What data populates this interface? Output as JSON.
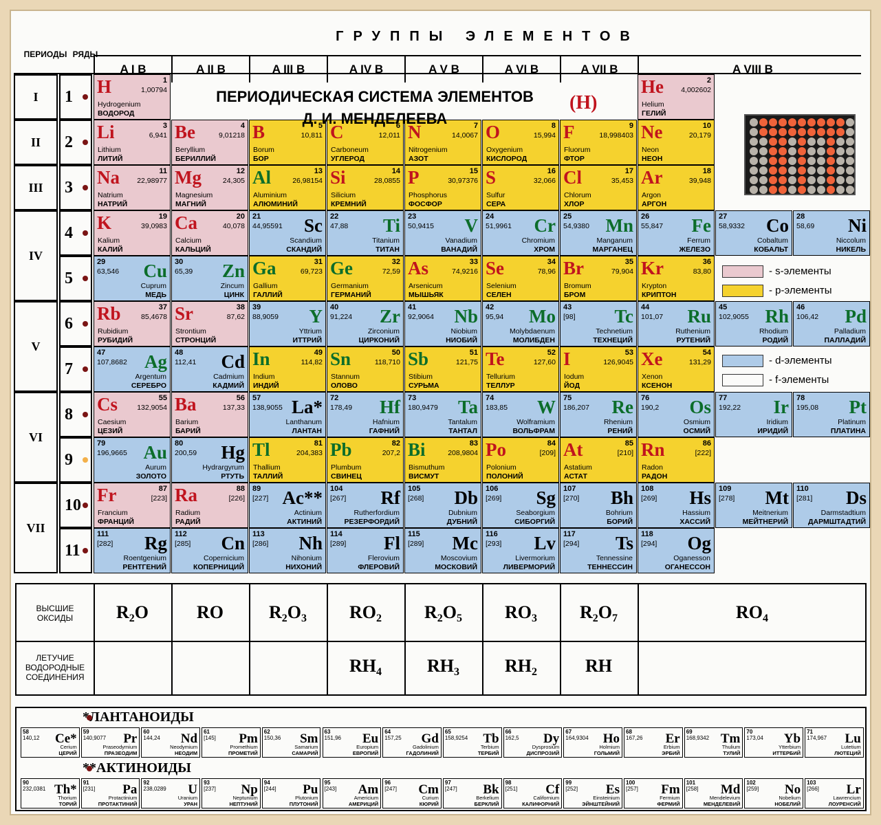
{
  "header": {
    "periods_label": "ПЕРИОДЫ",
    "rows_label": "РЯДЫ",
    "groups_title": "ГРУППЫ ЭЛЕМЕНТОВ",
    "group_labels": [
      "A I B",
      "A II B",
      "A III B",
      "A IV B",
      "A V B",
      "A VI B",
      "A VII B",
      "A VIII B"
    ]
  },
  "title": {
    "line1": "ПЕРИОДИЧЕСКАЯ СИСТЕМА ЭЛЕМЕНТОВ",
    "line2": "Д. И. МЕНДЕЛЕЕВА",
    "hydrogen_marker": "(H)"
  },
  "periods": [
    "I",
    "II",
    "III",
    "IV",
    "V",
    "VI",
    "VII"
  ],
  "rows": [
    "1",
    "2",
    "3",
    "4",
    "5",
    "6",
    "7",
    "8",
    "9",
    "10",
    "11"
  ],
  "legend": [
    "- s-элементы",
    "- p-элементы",
    "- d-элементы",
    "- f-элементы"
  ],
  "elements": [
    {
      "sym": "H",
      "num": "1",
      "mass": "1,00794",
      "lat": "Hydrogenium",
      "rus": "ВОДОРОД",
      "type": "s"
    },
    {
      "sym": "He",
      "num": "2",
      "mass": "4,002602",
      "lat": "Helium",
      "rus": "ГЕЛИЙ",
      "type": "s"
    },
    {
      "sym": "Li",
      "num": "3",
      "mass": "6,941",
      "lat": "Lithium",
      "rus": "ЛИТИЙ",
      "type": "s"
    },
    {
      "sym": "Be",
      "num": "4",
      "mass": "9,01218",
      "lat": "Beryllium",
      "rus": "БЕРИЛЛИЙ",
      "type": "s"
    },
    {
      "sym": "B",
      "num": "5",
      "mass": "10,811",
      "lat": "Borum",
      "rus": "БОР",
      "type": "p"
    },
    {
      "sym": "C",
      "num": "6",
      "mass": "12,011",
      "lat": "Carboneum",
      "rus": "УГЛЕРОД",
      "type": "p"
    },
    {
      "sym": "N",
      "num": "7",
      "mass": "14,0067",
      "lat": "Nitrogenium",
      "rus": "АЗОТ",
      "type": "p"
    },
    {
      "sym": "O",
      "num": "8",
      "mass": "15,994",
      "lat": "Oxygenium",
      "rus": "КИСЛОРОД",
      "type": "p"
    },
    {
      "sym": "F",
      "num": "9",
      "mass": "18,998403",
      "lat": "Fluorum",
      "rus": "ФТОР",
      "type": "p"
    },
    {
      "sym": "Ne",
      "num": "10",
      "mass": "20,179",
      "lat": "Neon",
      "rus": "НЕОН",
      "type": "p"
    },
    {
      "sym": "Na",
      "num": "11",
      "mass": "22,98977",
      "lat": "Natrium",
      "rus": "НАТРИЙ",
      "type": "s"
    },
    {
      "sym": "Mg",
      "num": "12",
      "mass": "24,305",
      "lat": "Magnesium",
      "rus": "МАГНИЙ",
      "type": "s"
    },
    {
      "sym": "Al",
      "num": "13",
      "mass": "26,98154",
      "lat": "Aluminium",
      "rus": "АЛЮМИНИЙ",
      "type": "p"
    },
    {
      "sym": "Si",
      "num": "14",
      "mass": "28,0855",
      "lat": "Silicium",
      "rus": "КРЕМНИЙ",
      "type": "p"
    },
    {
      "sym": "P",
      "num": "15",
      "mass": "30,97376",
      "lat": "Phosphorus",
      "rus": "ФОСФОР",
      "type": "p"
    },
    {
      "sym": "S",
      "num": "16",
      "mass": "32,066",
      "lat": "Sulfur",
      "rus": "СЕРА",
      "type": "p"
    },
    {
      "sym": "Cl",
      "num": "17",
      "mass": "35,453",
      "lat": "Chlorum",
      "rus": "ХЛОР",
      "type": "p"
    },
    {
      "sym": "Ar",
      "num": "18",
      "mass": "39,948",
      "lat": "Argon",
      "rus": "АРГОН",
      "type": "p"
    },
    {
      "sym": "K",
      "num": "19",
      "mass": "39,0983",
      "lat": "Kalium",
      "rus": "КАЛИЙ",
      "type": "s"
    },
    {
      "sym": "Ca",
      "num": "20",
      "mass": "40,078",
      "lat": "Calcium",
      "rus": "КАЛЬЦИЙ",
      "type": "s"
    },
    {
      "sym": "Sc",
      "num": "21",
      "mass": "44,95591",
      "lat": "Scandium",
      "rus": "СКАНДИЙ",
      "type": "d"
    },
    {
      "sym": "Ti",
      "num": "22",
      "mass": "47,88",
      "lat": "Titanium",
      "rus": "ТИТАН",
      "type": "d"
    },
    {
      "sym": "V",
      "num": "23",
      "mass": "50,9415",
      "lat": "Vanadium",
      "rus": "ВАНАДИЙ",
      "type": "d"
    },
    {
      "sym": "Cr",
      "num": "24",
      "mass": "51,9961",
      "lat": "Chromium",
      "rus": "ХРОМ",
      "type": "d"
    },
    {
      "sym": "Mn",
      "num": "25",
      "mass": "54,9380",
      "lat": "Manganum",
      "rus": "МАРГАНЕЦ",
      "type": "d"
    },
    {
      "sym": "Fe",
      "num": "26",
      "mass": "55,847",
      "lat": "Ferrum",
      "rus": "ЖЕЛЕЗО",
      "type": "d"
    },
    {
      "sym": "Co",
      "num": "27",
      "mass": "58,9332",
      "lat": "Cobaltum",
      "rus": "КОБАЛЬТ",
      "type": "d"
    },
    {
      "sym": "Ni",
      "num": "28",
      "mass": "58,69",
      "lat": "Niccolum",
      "rus": "НИКЕЛЬ",
      "type": "d"
    },
    {
      "sym": "Cu",
      "num": "29",
      "mass": "63,546",
      "lat": "Cuprum",
      "rus": "МЕДЬ",
      "type": "d"
    },
    {
      "sym": "Zn",
      "num": "30",
      "mass": "65,39",
      "lat": "Zincum",
      "rus": "ЦИНК",
      "type": "d"
    },
    {
      "sym": "Ga",
      "num": "31",
      "mass": "69,723",
      "lat": "Gallium",
      "rus": "ГАЛЛИЙ",
      "type": "p"
    },
    {
      "sym": "Ge",
      "num": "32",
      "mass": "72,59",
      "lat": "Germanium",
      "rus": "ГЕРМАНИЙ",
      "type": "p"
    },
    {
      "sym": "As",
      "num": "33",
      "mass": "74,9216",
      "lat": "Arsenicum",
      "rus": "МЫШЬЯК",
      "type": "p"
    },
    {
      "sym": "Se",
      "num": "34",
      "mass": "78,96",
      "lat": "Selenium",
      "rus": "СЕЛЕН",
      "type": "p"
    },
    {
      "sym": "Br",
      "num": "35",
      "mass": "79,904",
      "lat": "Bromum",
      "rus": "БРОМ",
      "type": "p"
    },
    {
      "sym": "Kr",
      "num": "36",
      "mass": "83,80",
      "lat": "Krypton",
      "rus": "КРИПТОН",
      "type": "p"
    },
    {
      "sym": "Rb",
      "num": "37",
      "mass": "85,4678",
      "lat": "Rubidium",
      "rus": "РУБИДИЙ",
      "type": "s"
    },
    {
      "sym": "Sr",
      "num": "38",
      "mass": "87,62",
      "lat": "Strontium",
      "rus": "СТРОНЦИЙ",
      "type": "s"
    },
    {
      "sym": "Y",
      "num": "39",
      "mass": "88,9059",
      "lat": "Yttrium",
      "rus": "ИТТРИЙ",
      "type": "d"
    },
    {
      "sym": "Zr",
      "num": "40",
      "mass": "91,224",
      "lat": "Zirconium",
      "rus": "ЦИРКОНИЙ",
      "type": "d"
    },
    {
      "sym": "Nb",
      "num": "41",
      "mass": "92,9064",
      "lat": "Niobium",
      "rus": "НИОБИЙ",
      "type": "d"
    },
    {
      "sym": "Mo",
      "num": "42",
      "mass": "95,94",
      "lat": "Molybdaenum",
      "rus": "МОЛИБДЕН",
      "type": "d"
    },
    {
      "sym": "Tc",
      "num": "43",
      "mass": "[98]",
      "lat": "Technetium",
      "rus": "ТЕХНЕЦИЙ",
      "type": "d"
    },
    {
      "sym": "Ru",
      "num": "44",
      "mass": "101,07",
      "lat": "Ruthenium",
      "rus": "РУТЕНИЙ",
      "type": "d"
    },
    {
      "sym": "Rh",
      "num": "45",
      "mass": "102,9055",
      "lat": "Rhodium",
      "rus": "РОДИЙ",
      "type": "d"
    },
    {
      "sym": "Pd",
      "num": "46",
      "mass": "106,42",
      "lat": "Palladium",
      "rus": "ПАЛЛАДИЙ",
      "type": "d"
    },
    {
      "sym": "Ag",
      "num": "47",
      "mass": "107,8682",
      "lat": "Argentum",
      "rus": "СЕРЕБРО",
      "type": "d"
    },
    {
      "sym": "Cd",
      "num": "48",
      "mass": "112,41",
      "lat": "Cadmium",
      "rus": "КАДМИЙ",
      "type": "d"
    },
    {
      "sym": "In",
      "num": "49",
      "mass": "114,82",
      "lat": "Indium",
      "rus": "ИНДИЙ",
      "type": "p"
    },
    {
      "sym": "Sn",
      "num": "50",
      "mass": "118,710",
      "lat": "Stannum",
      "rus": "ОЛОВО",
      "type": "p"
    },
    {
      "sym": "Sb",
      "num": "51",
      "mass": "121,75",
      "lat": "Stibium",
      "rus": "СУРЬМА",
      "type": "p"
    },
    {
      "sym": "Te",
      "num": "52",
      "mass": "127,60",
      "lat": "Tellurium",
      "rus": "ТЕЛЛУР",
      "type": "p"
    },
    {
      "sym": "I",
      "num": "53",
      "mass": "126,9045",
      "lat": "Iodum",
      "rus": "ЙОД",
      "type": "p"
    },
    {
      "sym": "Xe",
      "num": "54",
      "mass": "131,29",
      "lat": "Xenon",
      "rus": "КСЕНОН",
      "type": "p"
    },
    {
      "sym": "Cs",
      "num": "55",
      "mass": "132,9054",
      "lat": "Caesium",
      "rus": "ЦЕЗИЙ",
      "type": "s"
    },
    {
      "sym": "Ba",
      "num": "56",
      "mass": "137,33",
      "lat": "Barium",
      "rus": "БАРИЙ",
      "type": "s"
    },
    {
      "sym": "La*",
      "num": "57",
      "mass": "138,9055",
      "lat": "Lanthanum",
      "rus": "ЛАНТАН",
      "type": "d"
    },
    {
      "sym": "Hf",
      "num": "72",
      "mass": "178,49",
      "lat": "Hafnium",
      "rus": "ГАФНИЙ",
      "type": "d"
    },
    {
      "sym": "Ta",
      "num": "73",
      "mass": "180,9479",
      "lat": "Tantalum",
      "rus": "ТАНТАЛ",
      "type": "d"
    },
    {
      "sym": "W",
      "num": "74",
      "mass": "183,85",
      "lat": "Wolframium",
      "rus": "ВОЛЬФРАМ",
      "type": "d"
    },
    {
      "sym": "Re",
      "num": "75",
      "mass": "186,207",
      "lat": "Rhenium",
      "rus": "РЕНИЙ",
      "type": "d"
    },
    {
      "sym": "Os",
      "num": "76",
      "mass": "190,2",
      "lat": "Osmium",
      "rus": "ОСМИЙ",
      "type": "d"
    },
    {
      "sym": "Ir",
      "num": "77",
      "mass": "192,22",
      "lat": "Iridium",
      "rus": "ИРИДИЙ",
      "type": "d"
    },
    {
      "sym": "Pt",
      "num": "78",
      "mass": "195,08",
      "lat": "Platinum",
      "rus": "ПЛАТИНА",
      "type": "d"
    },
    {
      "sym": "Au",
      "num": "79",
      "mass": "196,9665",
      "lat": "Aurum",
      "rus": "ЗОЛОТО",
      "type": "d"
    },
    {
      "sym": "Hg",
      "num": "80",
      "mass": "200,59",
      "lat": "Hydrargyrum",
      "rus": "РТУТЬ",
      "type": "d"
    },
    {
      "sym": "Tl",
      "num": "81",
      "mass": "204,383",
      "lat": "Thallium",
      "rus": "ТАЛЛИЙ",
      "type": "p"
    },
    {
      "sym": "Pb",
      "num": "82",
      "mass": "207,2",
      "lat": "Plumbum",
      "rus": "СВИНЕЦ",
      "type": "p"
    },
    {
      "sym": "Bi",
      "num": "83",
      "mass": "208,9804",
      "lat": "Bismuthum",
      "rus": "ВИСМУТ",
      "type": "p"
    },
    {
      "sym": "Po",
      "num": "84",
      "mass": "[209]",
      "lat": "Polonium",
      "rus": "ПОЛОНИЙ",
      "type": "p"
    },
    {
      "sym": "At",
      "num": "85",
      "mass": "[210]",
      "lat": "Astatium",
      "rus": "АСТАТ",
      "type": "p"
    },
    {
      "sym": "Rn",
      "num": "86",
      "mass": "[222]",
      "lat": "Radon",
      "rus": "РАДОН",
      "type": "p"
    },
    {
      "sym": "Fr",
      "num": "87",
      "mass": "[223]",
      "lat": "Francium",
      "rus": "ФРАНЦИЙ",
      "type": "s"
    },
    {
      "sym": "Ra",
      "num": "88",
      "mass": "[226]",
      "lat": "Radium",
      "rus": "РАДИЙ",
      "type": "s"
    },
    {
      "sym": "Ac**",
      "num": "89",
      "mass": "[227]",
      "lat": "Actinium",
      "rus": "АКТИНИЙ",
      "type": "d"
    },
    {
      "sym": "Rf",
      "num": "104",
      "mass": "[267]",
      "lat": "Rutherfordium",
      "rus": "РЕЗЕРФОРДИЙ",
      "type": "d"
    },
    {
      "sym": "Db",
      "num": "105",
      "mass": "[268]",
      "lat": "Dubnium",
      "rus": "ДУБНИЙ",
      "type": "d"
    },
    {
      "sym": "Sg",
      "num": "106",
      "mass": "[269]",
      "lat": "Seaborgium",
      "rus": "СИБОРГИЙ",
      "type": "d"
    },
    {
      "sym": "Bh",
      "num": "107",
      "mass": "[270]",
      "lat": "Bohrium",
      "rus": "БОРИЙ",
      "type": "d"
    },
    {
      "sym": "Hs",
      "num": "108",
      "mass": "[269]",
      "lat": "Hassium",
      "rus": "ХАССИЙ",
      "type": "d"
    },
    {
      "sym": "Mt",
      "num": "109",
      "mass": "[278]",
      "lat": "Meitnerium",
      "rus": "МЕЙТНЕРИЙ",
      "type": "d"
    },
    {
      "sym": "Ds",
      "num": "110",
      "mass": "[281]",
      "lat": "Darmstadtium",
      "rus": "ДАРМШТАДТИЙ",
      "type": "d"
    },
    {
      "sym": "Rg",
      "num": "111",
      "mass": "[282]",
      "lat": "Roentgenium",
      "rus": "РЕНТГЕНИЙ",
      "type": "d"
    },
    {
      "sym": "Cn",
      "num": "112",
      "mass": "[285]",
      "lat": "Copernicium",
      "rus": "КОПЕРНИЦИЙ",
      "type": "d"
    },
    {
      "sym": "Nh",
      "num": "113",
      "mass": "[286]",
      "lat": "Nihonium",
      "rus": "НИХОНИЙ",
      "type": "d"
    },
    {
      "sym": "Fl",
      "num": "114",
      "mass": "[289]",
      "lat": "Flerovium",
      "rus": "ФЛЕРОВИЙ",
      "type": "d"
    },
    {
      "sym": "Mc",
      "num": "115",
      "mass": "[289]",
      "lat": "Moscovium",
      "rus": "МОСКОВИЙ",
      "type": "d"
    },
    {
      "sym": "Lv",
      "num": "116",
      "mass": "[293]",
      "lat": "Livermorium",
      "rus": "ЛИВЕРМОРИЙ",
      "type": "d"
    },
    {
      "sym": "Ts",
      "num": "117",
      "mass": "[294]",
      "lat": "Tennessine",
      "rus": "ТЕННЕССИН",
      "type": "d"
    },
    {
      "sym": "Og",
      "num": "118",
      "mass": "[294]",
      "lat": "Oganesson",
      "rus": "ОГАНЕССОН",
      "type": "d"
    }
  ],
  "oxides_label": "ВЫСШИЕ ОКСИДЫ",
  "hydrides_label": "ЛЕТУЧИЕ ВОДОРОДНЫЕ СОЕДИНЕНИЯ",
  "oxides": [
    {
      "base": "R",
      "s1": "2",
      "mid": "O",
      "s2": ""
    },
    {
      "base": "RO",
      "s1": "",
      "mid": "",
      "s2": ""
    },
    {
      "base": "R",
      "s1": "2",
      "mid": "O",
      "s2": "3"
    },
    {
      "base": "RO",
      "s1": "2",
      "mid": "",
      "s2": ""
    },
    {
      "base": "R",
      "s1": "2",
      "mid": "O",
      "s2": "5"
    },
    {
      "base": "RO",
      "s1": "3",
      "mid": "",
      "s2": ""
    },
    {
      "base": "R",
      "s1": "2",
      "mid": "O",
      "s2": "7"
    },
    {
      "base": "RO",
      "s1": "4",
      "mid": "",
      "s2": ""
    }
  ],
  "hydrides": [
    {
      "base": "RH",
      "s1": "4"
    },
    {
      "base": "RH",
      "s1": "3"
    },
    {
      "base": "RH",
      "s1": "2"
    },
    {
      "base": "RH",
      "s1": ""
    }
  ],
  "lanthanides_title": "*ЛАНТАНОИДЫ",
  "actinides_title": "**АКТИНОИДЫ",
  "lanthanides": [
    {
      "sym": "Ce*",
      "num": "58",
      "mass": "140,12",
      "lat": "Cerium",
      "rus": "ЦЕРИЙ"
    },
    {
      "sym": "Pr",
      "num": "59",
      "mass": "140,9077",
      "lat": "Praseodymium",
      "rus": "ПРАЗЕОДИМ"
    },
    {
      "sym": "Nd",
      "num": "60",
      "mass": "144,24",
      "lat": "Neodymium",
      "rus": "НЕОДИМ"
    },
    {
      "sym": "Pm",
      "num": "61",
      "mass": "[145]",
      "lat": "Promethium",
      "rus": "ПРОМЕТИЙ"
    },
    {
      "sym": "Sm",
      "num": "62",
      "mass": "150,36",
      "lat": "Samarium",
      "rus": "САМАРИЙ"
    },
    {
      "sym": "Eu",
      "num": "63",
      "mass": "151,96",
      "lat": "Europium",
      "rus": "ЕВРОПИЙ"
    },
    {
      "sym": "Gd",
      "num": "64",
      "mass": "157,25",
      "lat": "Gadolinium",
      "rus": "ГАДОЛИНИЙ"
    },
    {
      "sym": "Tb",
      "num": "65",
      "mass": "158,9254",
      "lat": "Terbium",
      "rus": "ТЕРБИЙ"
    },
    {
      "sym": "Dy",
      "num": "66",
      "mass": "162,5",
      "lat": "Dysprosium",
      "rus": "ДИСПРОЗИЙ"
    },
    {
      "sym": "Ho",
      "num": "67",
      "mass": "164,9304",
      "lat": "Holmium",
      "rus": "ГОЛЬМИЙ"
    },
    {
      "sym": "Er",
      "num": "68",
      "mass": "167,26",
      "lat": "Erbium",
      "rus": "ЭРБИЙ"
    },
    {
      "sym": "Tm",
      "num": "69",
      "mass": "168,9342",
      "lat": "Thulium",
      "rus": "ТУЛИЙ"
    },
    {
      "sym": "Yb",
      "num": "70",
      "mass": "173,04",
      "lat": "Ytterbium",
      "rus": "ИТТЕРБИЙ"
    },
    {
      "sym": "Lu",
      "num": "71",
      "mass": "174,967",
      "lat": "Lutetium",
      "rus": "ЛЮТЕЦИЙ"
    }
  ],
  "actinides": [
    {
      "sym": "Th*",
      "num": "90",
      "mass": "232,0381",
      "lat": "Thorium",
      "rus": "ТОРИЙ"
    },
    {
      "sym": "Pa",
      "num": "91",
      "mass": "[231]",
      "lat": "Protactinium",
      "rus": "ПРОТАКТИНИЙ"
    },
    {
      "sym": "U",
      "num": "92",
      "mass": "238,0289",
      "lat": "Uranium",
      "rus": "УРАН"
    },
    {
      "sym": "Np",
      "num": "93",
      "mass": "[237]",
      "lat": "Neptunium",
      "rus": "НЕПТУНИЙ"
    },
    {
      "sym": "Pu",
      "num": "94",
      "mass": "[244]",
      "lat": "Plutonium",
      "rus": "ПЛУТОНИЙ"
    },
    {
      "sym": "Am",
      "num": "95",
      "mass": "[243]",
      "lat": "Americium",
      "rus": "АМЕРИЦИЙ"
    },
    {
      "sym": "Cm",
      "num": "96",
      "mass": "[247]",
      "lat": "Curium",
      "rus": "КЮРИЙ"
    },
    {
      "sym": "Bk",
      "num": "97",
      "mass": "[247]",
      "lat": "Berkelium",
      "rus": "БЕРКЛИЙ"
    },
    {
      "sym": "Cf",
      "num": "98",
      "mass": "[251]",
      "lat": "Californium",
      "rus": "КАЛИФОРНИЙ"
    },
    {
      "sym": "Es",
      "num": "99",
      "mass": "[252]",
      "lat": "Einsteinium",
      "rus": "ЭЙНШТЕЙНИЙ"
    },
    {
      "sym": "Fm",
      "num": "100",
      "mass": "[257]",
      "lat": "Fermium",
      "rus": "ФЕРМИЙ"
    },
    {
      "sym": "Md",
      "num": "101",
      "mass": "[258]",
      "lat": "Mendelevium",
      "rus": "МЕНДЕЛЕВИЙ"
    },
    {
      "sym": "No",
      "num": "102",
      "mass": "[259]",
      "lat": "Nobelium",
      "rus": "НОБЕЛИЙ"
    },
    {
      "sym": "Lr",
      "num": "103",
      "mass": "[266]",
      "lat": "Lawrencium",
      "rus": "ЛОУРЕНСИЙ"
    }
  ],
  "colors": {
    "s": "#eac9cf",
    "p": "#f5d22e",
    "d": "#aecbe8",
    "f": "#fbfbf9",
    "symbol_red": "#c0141e",
    "symbol_green": "#0c6d2a"
  }
}
